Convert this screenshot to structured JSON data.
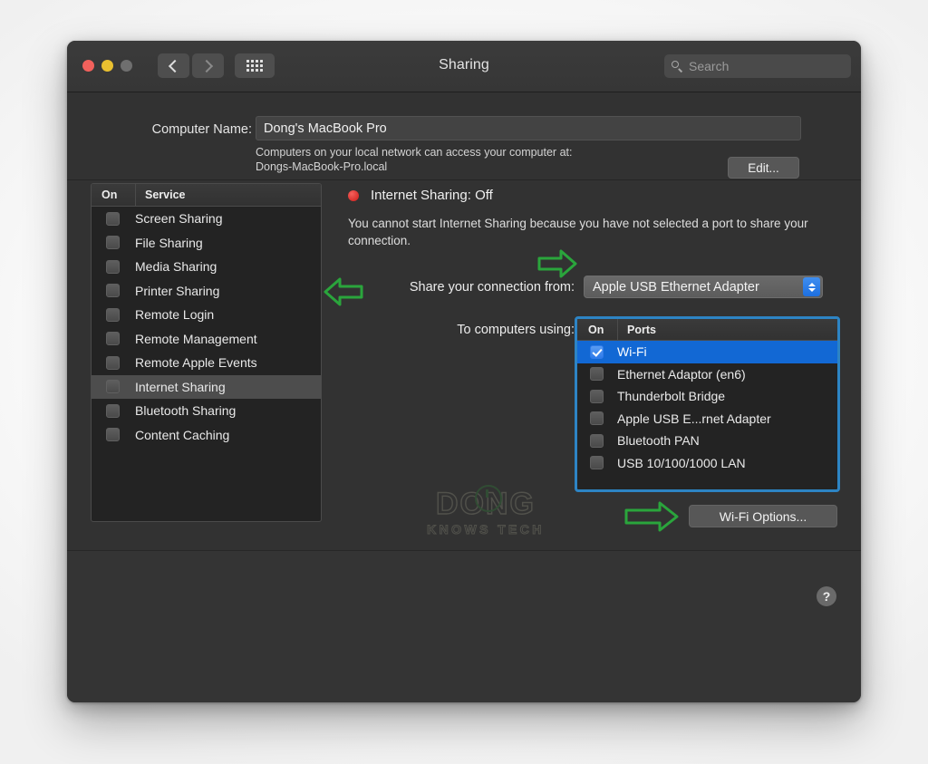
{
  "window": {
    "title": "Sharing",
    "traffic_lights": [
      "close",
      "minimize",
      "zoom"
    ],
    "search_placeholder": "Search",
    "nav_back": "back-arrow",
    "nav_forward": "forward-arrow",
    "grid_button": "show-all-icon"
  },
  "computer_name": {
    "label": "Computer Name:",
    "value": "Dong's MacBook Pro",
    "help_line1": "Computers on your local network can access your computer at:",
    "help_line2": "Dongs-MacBook-Pro.local",
    "edit_button": "Edit..."
  },
  "services_table": {
    "col_on": "On",
    "col_service": "Service",
    "rows": [
      {
        "name": "Screen Sharing",
        "on": false,
        "selected": false
      },
      {
        "name": "File Sharing",
        "on": false,
        "selected": false
      },
      {
        "name": "Media Sharing",
        "on": false,
        "selected": false
      },
      {
        "name": "Printer Sharing",
        "on": false,
        "selected": false
      },
      {
        "name": "Remote Login",
        "on": false,
        "selected": false
      },
      {
        "name": "Remote Management",
        "on": false,
        "selected": false
      },
      {
        "name": "Remote Apple Events",
        "on": false,
        "selected": false
      },
      {
        "name": "Internet Sharing",
        "on": false,
        "selected": true
      },
      {
        "name": "Bluetooth Sharing",
        "on": false,
        "selected": false
      },
      {
        "name": "Content Caching",
        "on": false,
        "selected": false
      }
    ]
  },
  "detail": {
    "status_title": "Internet Sharing: Off",
    "status_color": "#d8302c",
    "status_description": "You cannot start Internet Sharing because you have not selected a port to share your connection.",
    "share_from_label": "Share your connection from:",
    "share_from_value": "Apple USB Ethernet Adapter",
    "to_computers_label": "To computers using:",
    "wifi_options_button": "Wi-Fi Options..."
  },
  "ports_table": {
    "col_on": "On",
    "col_ports": "Ports",
    "rows": [
      {
        "name": "Wi-Fi",
        "on": true,
        "selected": true
      },
      {
        "name": "Ethernet Adaptor (en6)",
        "on": false,
        "selected": false
      },
      {
        "name": "Thunderbolt Bridge",
        "on": false,
        "selected": false
      },
      {
        "name": "Apple USB E...rnet Adapter",
        "on": false,
        "selected": false
      },
      {
        "name": "Bluetooth PAN",
        "on": false,
        "selected": false
      },
      {
        "name": "USB 10/100/1000 LAN",
        "on": false,
        "selected": false
      }
    ]
  },
  "annotations": {
    "color": "#2aa53c",
    "arrow_internet_sharing": "left-arrow",
    "arrow_ports_list": "right-arrow",
    "arrow_wifi_options": "right-arrow"
  },
  "watermark": {
    "main": "DONG",
    "sub": "KNOWS TECH"
  },
  "footer": {
    "help_button": "?"
  }
}
